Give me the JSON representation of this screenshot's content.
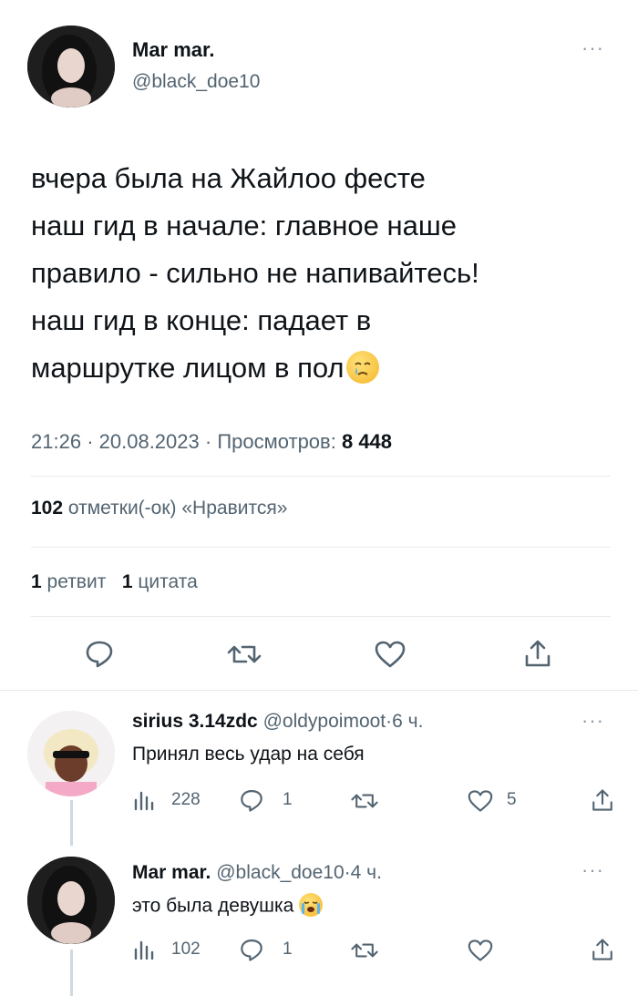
{
  "main_tweet": {
    "display_name": "Mar mar.",
    "handle": "@black_doe10",
    "lines": [
      "вчера была на Жайлоо фесте",
      "наш гид в начале: главное наше",
      "правило - сильно не напивайтесь!",
      "наш гид в конце: падает в",
      "маршрутке лицом в пол"
    ],
    "emoji_icon": "crying-face-emoji",
    "time": "21:26",
    "date": "20.08.2023",
    "views_label": "Просмотров:",
    "views_count": "8 448",
    "likes_count": "102",
    "likes_label": "отметки(-ок) «Нравится»",
    "retweets_count": "1",
    "retweets_label": "ретвит",
    "quotes_count": "1",
    "quotes_label": "цитата",
    "separator": "·"
  },
  "replies": [
    {
      "display_name": "sirius 3.14zdc",
      "handle": "@oldypoimoot",
      "age": "6 ч.",
      "text": "Принял весь удар на себя",
      "views": "228",
      "replies": "1",
      "retweets": "",
      "likes": "5"
    },
    {
      "display_name": "Mar mar.",
      "handle": "@black_doe10",
      "age": "4 ч.",
      "text": "это была девушка",
      "emoji_icon": "loudly-crying-face-emoji",
      "views": "102",
      "replies": "1",
      "retweets": "",
      "likes": ""
    }
  ],
  "colors": {
    "text": "#0f1419",
    "muted": "#536471",
    "divider": "#e7ebee"
  }
}
